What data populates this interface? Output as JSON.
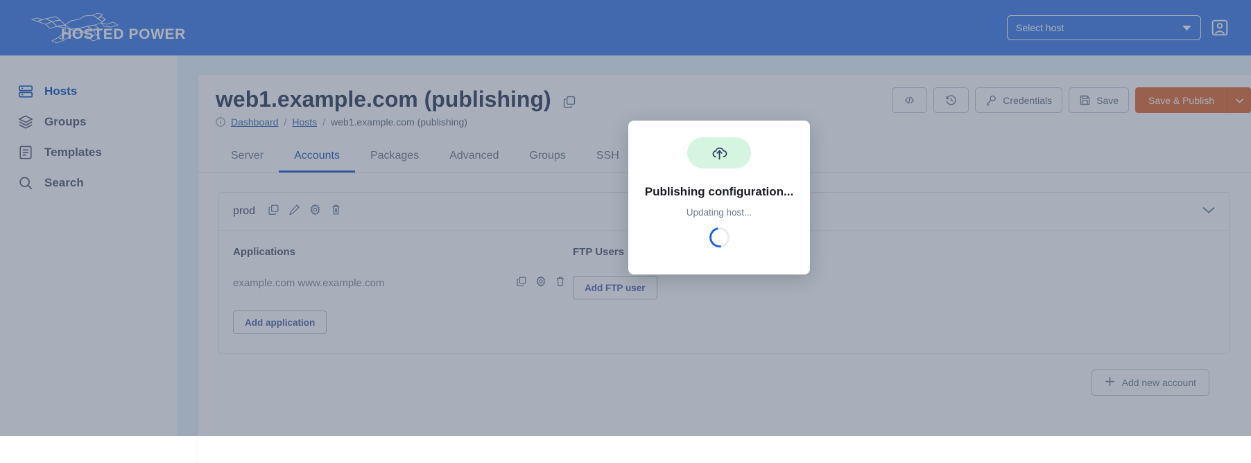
{
  "brand": {
    "name": "HOSTED POWER",
    "logo_icon": "cheetah-logo-icon",
    "bar_color": "#4680e8"
  },
  "topbar": {
    "host_select": {
      "value": "Select host",
      "placeholder": "Select host",
      "caret_icon": "chevron-down-icon"
    },
    "account_icon": "account-badge-icon"
  },
  "sidebar": {
    "items": [
      {
        "label": "Hosts",
        "icon": "server-icon",
        "active": true
      },
      {
        "label": "Groups",
        "icon": "layers-icon",
        "active": false
      },
      {
        "label": "Templates",
        "icon": "document-icon",
        "active": false
      },
      {
        "label": "Search",
        "icon": "search-icon",
        "active": false
      }
    ]
  },
  "header": {
    "title": "web1.example.com (publishing)",
    "copy_icon": "copy-icon",
    "breadcrumb": {
      "info_icon": "info-icon",
      "items": [
        {
          "label": "Dashboard",
          "link": true
        },
        {
          "label": "Hosts",
          "link": true
        },
        {
          "label": "web1.example.com (publishing)",
          "link": false
        }
      ],
      "separator": "/"
    }
  },
  "toolbar": {
    "code_icon": "code-brackets-icon",
    "history_icon": "history-clock-icon",
    "credentials_label": "Credentials",
    "credentials_icon": "key-icon",
    "save_label": "Save",
    "save_icon": "floppy-disk-icon",
    "publish_label": "Save & Publish",
    "publish_caret_icon": "chevron-down-icon",
    "publish_color": "#e2703a"
  },
  "tabs": [
    {
      "label": "Server",
      "active": false
    },
    {
      "label": "Accounts",
      "active": true
    },
    {
      "label": "Packages",
      "active": false
    },
    {
      "label": "Advanced",
      "active": false
    },
    {
      "label": "Groups",
      "active": false
    },
    {
      "label": "SSH",
      "active": false
    }
  ],
  "account_card": {
    "name": "prod",
    "actions": [
      {
        "icon": "copy-icon"
      },
      {
        "icon": "edit-pencil-icon"
      },
      {
        "icon": "gear-icon"
      },
      {
        "icon": "trash-icon"
      }
    ],
    "collapse_icon": "chevron-down-icon",
    "applications": {
      "heading": "Applications",
      "rows": [
        {
          "domains": "example.com www.example.com",
          "actions": [
            {
              "icon": "copy-icon"
            },
            {
              "icon": "gear-icon"
            },
            {
              "icon": "trash-icon"
            }
          ]
        }
      ],
      "add_label": "Add application"
    },
    "ftp_users": {
      "heading": "FTP Users",
      "rows": [],
      "add_label": "Add FTP user"
    }
  },
  "footer": {
    "add_account_label": "Add new account",
    "add_account_icon": "plus-icon"
  },
  "modal": {
    "badge_icon": "cloud-upload-icon",
    "badge_color": "#d6f5e0",
    "title": "Publishing configuration...",
    "subtitle": "Updating host...",
    "spinner_icon": "loading-spinner-icon",
    "spinner_color": "#1f63dd"
  }
}
